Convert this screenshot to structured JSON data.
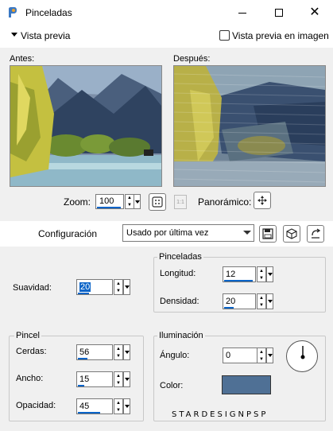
{
  "window": {
    "title": "Pinceladas"
  },
  "preview": {
    "section_label": "Vista previa",
    "image_preview_label": "Vista previa en imagen",
    "before_label": "Antes:",
    "after_label": "Después:",
    "zoom_label": "Zoom:",
    "zoom_value": "100",
    "one_to_one": "1:1",
    "pan_label": "Panorámico:"
  },
  "config": {
    "label": "Configuración",
    "selected": "Usado por última vez"
  },
  "settings": {
    "smoothness": {
      "label": "Suavidad:",
      "value": "20"
    },
    "strokes_group": "Pinceladas",
    "length": {
      "label": "Longitud:",
      "value": "12"
    },
    "density": {
      "label": "Densidad:",
      "value": "20"
    },
    "brush_group": "Pincel",
    "bristles": {
      "label": "Cerdas:",
      "value": "56"
    },
    "width": {
      "label": "Ancho:",
      "value": "15"
    },
    "opacity": {
      "label": "Opacidad:",
      "value": "45"
    },
    "lighting_group": "Iluminación",
    "angle": {
      "label": "Ángulo:",
      "value": "0"
    },
    "color": {
      "label": "Color:",
      "value": "#4f7095"
    }
  },
  "watermark": "STARDESIGNPSP",
  "colors": {
    "accent": "#0a64c8",
    "panel": "#f0f0f0"
  }
}
